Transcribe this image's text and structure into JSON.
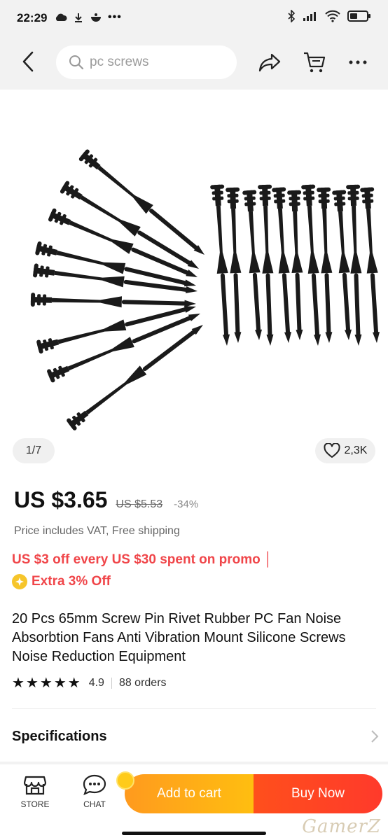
{
  "status_bar": {
    "time": "22:29"
  },
  "nav": {
    "search_placeholder": "pc screws",
    "icons": [
      "back-icon",
      "search-icon",
      "share-icon",
      "cart-icon",
      "more-icon"
    ]
  },
  "gallery": {
    "counter": "1/7",
    "wish_count": "2,3K"
  },
  "price": {
    "current": "US $3.65",
    "original": "US $5.53",
    "discount": "-34%",
    "vat_note": "Price includes VAT, Free shipping"
  },
  "promo": {
    "line1": "US $3 off every US $30 spent on promo │",
    "extra": "Extra 3% Off"
  },
  "product": {
    "title": "20 Pcs 65mm Screw Pin Rivet Rubber PC Fan Noise Absorbtion Fans Anti Vibration Mount Silicone Screws Noise Reduction Equipment",
    "rating": "4.9",
    "rating_stars": 5,
    "orders": "88 orders"
  },
  "specs": {
    "label": "Specifications"
  },
  "bottom_bar": {
    "store_label": "STORE",
    "chat_label": "CHAT",
    "add_to_cart": "Add to cart",
    "buy_now": "Buy Now"
  },
  "watermark": "GamerZ",
  "colors": {
    "promo_red": "#f0464a",
    "cart_orange": "#ffa51a",
    "buy_red": "#ff4220",
    "star": "#111111"
  }
}
